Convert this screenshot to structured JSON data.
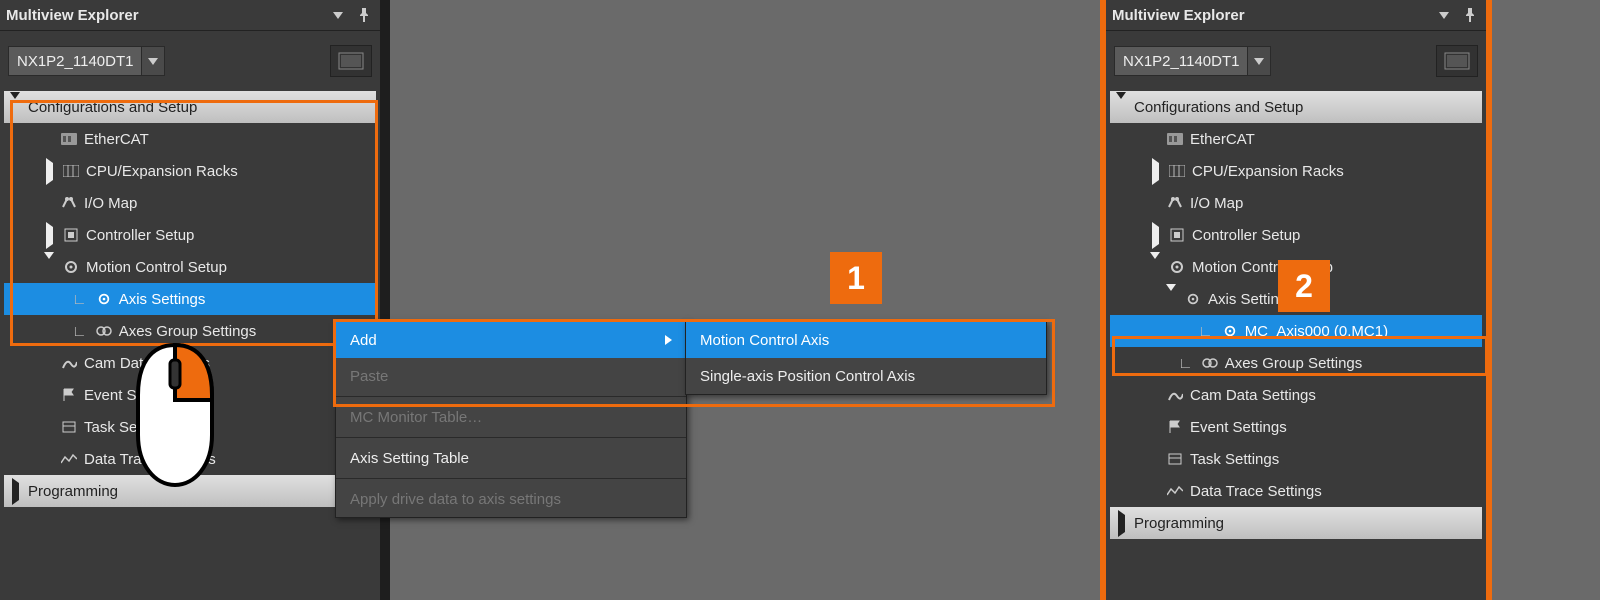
{
  "panelA": {
    "title": "Multiview Explorer",
    "device": "NX1P2_1140DT1",
    "tree": {
      "config_header": "Configurations and Setup",
      "ethercat": "EtherCAT",
      "cpu": "CPU/Expansion Racks",
      "iomap": "I/O Map",
      "ctrl": "Controller Setup",
      "mcs": "Motion Control Setup",
      "axis": "Axis Settings",
      "axesgrp": "Axes Group Settings",
      "cam": "Cam Data Settings",
      "evt": "Event Settings",
      "task": "Task Settings",
      "dtrace": "Data Trace Settings",
      "prog_header": "Programming"
    }
  },
  "panelB": {
    "title": "Multiview Explorer",
    "device": "NX1P2_1140DT1",
    "tree": {
      "config_header": "Configurations and Setup",
      "ethercat": "EtherCAT",
      "cpu": "CPU/Expansion Racks",
      "iomap": "I/O Map",
      "ctrl": "Controller Setup",
      "mcs": "Motion Control Setup",
      "axis": "Axis Settings",
      "mcaxis": "MC_Axis000 (0,MC1)",
      "axesgrp": "Axes Group Settings",
      "cam": "Cam Data Settings",
      "evt": "Event Settings",
      "task": "Task Settings",
      "dtrace": "Data Trace Settings",
      "prog_header": "Programming"
    }
  },
  "ctx": {
    "add": "Add",
    "paste": "Paste",
    "mcmon": "MC Monitor Table…",
    "axistable": "Axis Setting Table",
    "applydrive": "Apply drive data to axis settings"
  },
  "submenu": {
    "motion": "Motion Control Axis",
    "single": "Single-axis Position Control Axis"
  },
  "callouts": {
    "one": "1",
    "two": "2"
  }
}
